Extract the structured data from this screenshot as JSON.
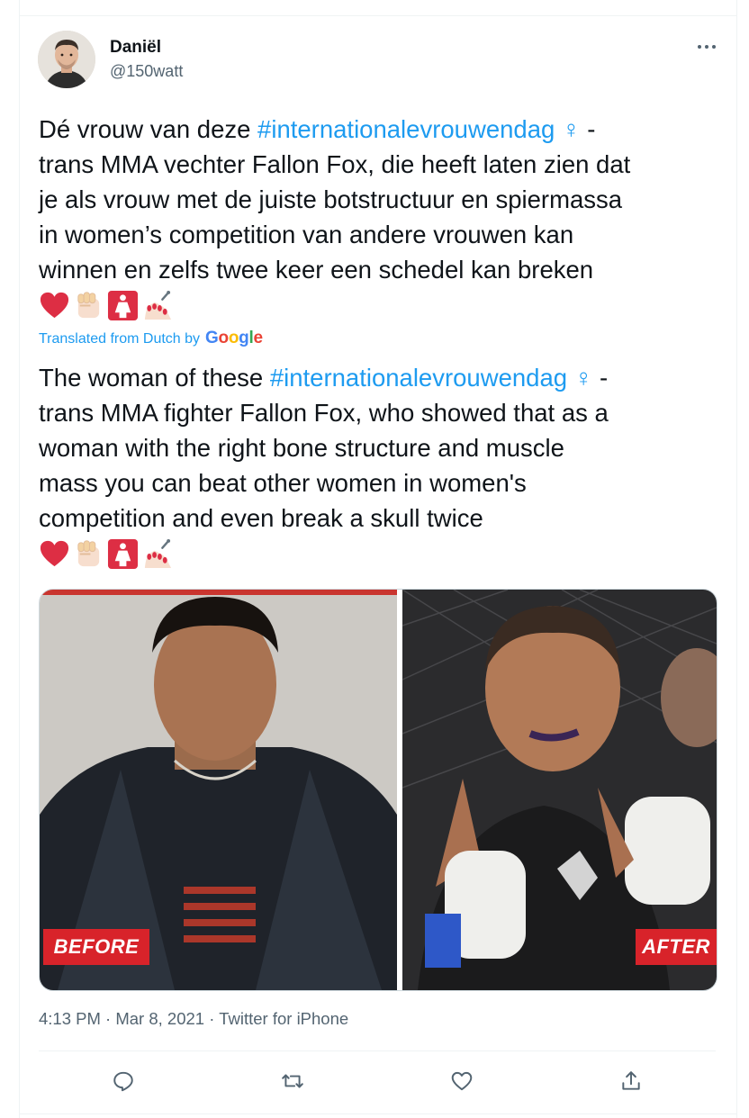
{
  "author": {
    "name": "Daniël",
    "handle": "@150watt"
  },
  "tweet": {
    "original_lines": [
      [
        "Dé vrouw van deze ",
        "#internationalevrouwendag",
        "♀",
        " -"
      ],
      "trans MMA vechter Fallon Fox, die heeft laten zien dat",
      "je als vrouw met de juiste botstructuur en spiermassa",
      "in women’s competition van andere vrouwen kan",
      "winnen en zelfs twee keer een schedel kan breken"
    ],
    "translated_label": "Translated from Dutch by",
    "translated_brand": "Google",
    "translated_lines": [
      [
        "The woman of these ",
        "#internationalevrouwendag",
        "♀",
        " -"
      ],
      "trans MMA fighter Fallon Fox, who showed that as a",
      "woman with the right bone structure and muscle",
      "mass you can beat other women in women's",
      "competition and even break a skull twice"
    ],
    "emoji_icons": [
      "red-heart-icon",
      "raised-fist-icon",
      "womens-room-icon",
      "nail-polish-icon"
    ]
  },
  "media": {
    "left_label": "BEFORE",
    "right_label": "AFTER"
  },
  "meta": {
    "time": "4:13 PM",
    "sep": "·",
    "date": "Mar 8, 2021",
    "source": "Twitter for iPhone"
  },
  "colors": {
    "accent": "#1d9bf0",
    "label_red": "#d8232a",
    "text": "#0f1419",
    "muted": "#536471"
  }
}
